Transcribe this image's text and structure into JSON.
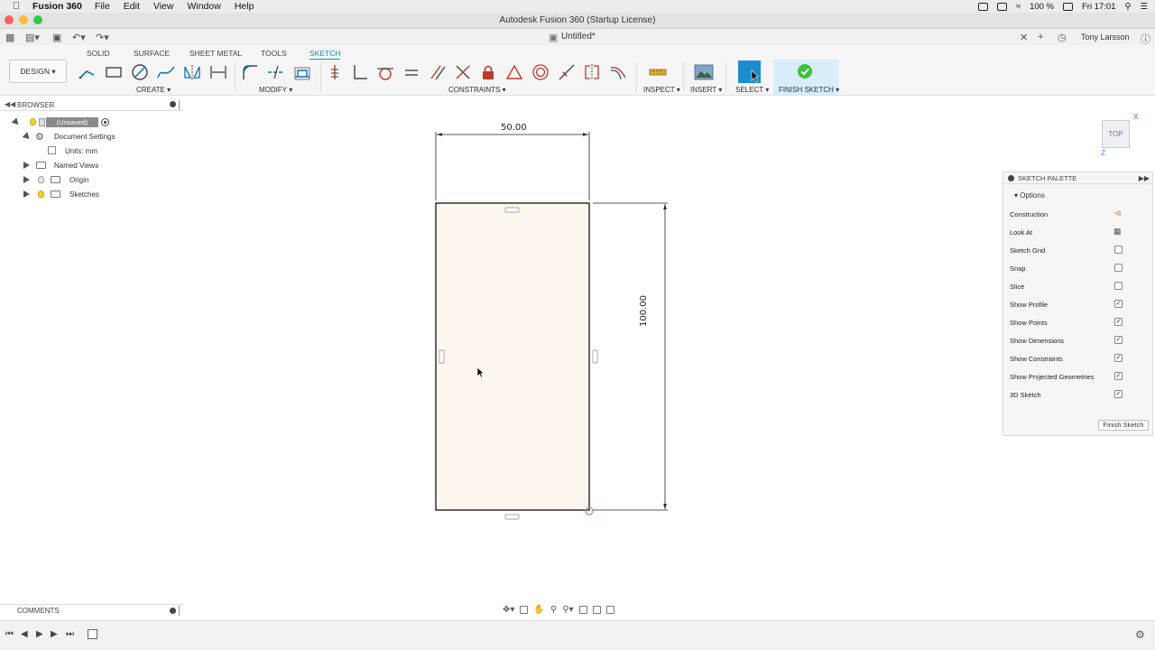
{
  "menubar": {
    "app_name": "Fusion 360",
    "items": [
      "File",
      "Edit",
      "View",
      "Window",
      "Help"
    ],
    "battery": "100 %",
    "clock": "Fri 17:01"
  },
  "window": {
    "title": "Autodesk Fusion 360 (Startup License)"
  },
  "qat": {
    "document_name": "Untitled*",
    "user": "Tony Larsson"
  },
  "ribbon": {
    "tabs": [
      "SOLID",
      "SURFACE",
      "SHEET METAL",
      "TOOLS",
      "SKETCH"
    ],
    "active_tab": "SKETCH",
    "workspace": "DESIGN",
    "groups": {
      "create": "CREATE",
      "modify": "MODIFY",
      "constraints": "CONSTRAINTS",
      "inspect": "INSPECT",
      "insert": "INSERT",
      "select": "SELECT",
      "finish": "FINISH SKETCH"
    }
  },
  "browser": {
    "title": "BROWSER",
    "root": "(Unsaved)",
    "nodes": [
      "Document Settings",
      "Units: mm",
      "Named Views",
      "Origin",
      "Sketches"
    ]
  },
  "canvas": {
    "viewcube_label": "TOP",
    "dim_width": "50.00",
    "dim_height": "100.00"
  },
  "palette": {
    "title": "SKETCH PALETTE",
    "section": "Options",
    "options": [
      {
        "label": "Construction",
        "checked": false
      },
      {
        "label": "Look At",
        "checked": false
      },
      {
        "label": "Sketch Grid",
        "checked": false
      },
      {
        "label": "Snap",
        "checked": false
      },
      {
        "label": "Slice",
        "checked": false
      },
      {
        "label": "Show Profile",
        "checked": true
      },
      {
        "label": "Show Points",
        "checked": true
      },
      {
        "label": "Show Dimensions",
        "checked": true
      },
      {
        "label": "Show Constraints",
        "checked": true
      },
      {
        "label": "Show Projected Geometries",
        "checked": true
      },
      {
        "label": "3D Sketch",
        "checked": true
      }
    ],
    "finish_button": "Finish Sketch"
  },
  "comments": {
    "title": "COMMENTS"
  },
  "colors": {
    "accent": "#0696d7",
    "profile_fill": "#fdf6ef",
    "finish_green": "#3cc13b"
  }
}
